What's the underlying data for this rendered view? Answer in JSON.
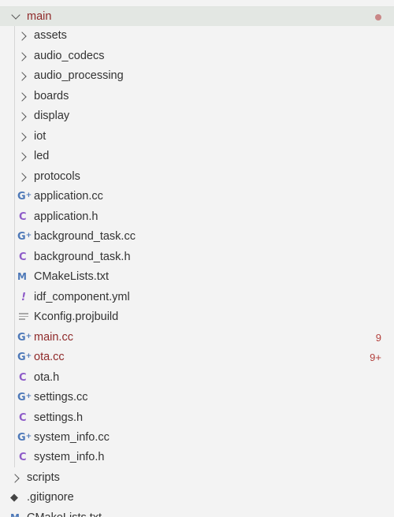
{
  "explorer": {
    "root_folder": {
      "label": "main",
      "expanded": true,
      "status_dot_color": "#c98787"
    },
    "folders": [
      {
        "label": "assets"
      },
      {
        "label": "audio_codecs"
      },
      {
        "label": "audio_processing"
      },
      {
        "label": "boards"
      },
      {
        "label": "display"
      },
      {
        "label": "iot"
      },
      {
        "label": "led"
      },
      {
        "label": "protocols"
      }
    ],
    "files": [
      {
        "label": "application.cc",
        "icon": "cpp-file-icon",
        "badge": ""
      },
      {
        "label": "application.h",
        "icon": "c-header-file-icon",
        "badge": ""
      },
      {
        "label": "background_task.cc",
        "icon": "cpp-file-icon",
        "badge": ""
      },
      {
        "label": "background_task.h",
        "icon": "c-header-file-icon",
        "badge": ""
      },
      {
        "label": "CMakeLists.txt",
        "icon": "cmake-file-icon",
        "badge": ""
      },
      {
        "label": "idf_component.yml",
        "icon": "yaml-file-icon",
        "badge": ""
      },
      {
        "label": "Kconfig.projbuild",
        "icon": "text-file-icon",
        "badge": ""
      },
      {
        "label": "main.cc",
        "icon": "cpp-file-icon",
        "badge": "9"
      },
      {
        "label": "ota.cc",
        "icon": "cpp-file-icon",
        "badge": "9+"
      },
      {
        "label": "ota.h",
        "icon": "c-header-file-icon",
        "badge": ""
      },
      {
        "label": "settings.cc",
        "icon": "cpp-file-icon",
        "badge": ""
      },
      {
        "label": "settings.h",
        "icon": "c-header-file-icon",
        "badge": ""
      },
      {
        "label": "system_info.cc",
        "icon": "cpp-file-icon",
        "badge": ""
      },
      {
        "label": "system_info.h",
        "icon": "c-header-file-icon",
        "badge": ""
      }
    ],
    "sibling_folder": {
      "label": "scripts"
    },
    "root_files": [
      {
        "label": ".gitignore",
        "icon": "git-file-icon"
      },
      {
        "label": "CMakeLists.txt",
        "icon": "cmake-file-icon"
      }
    ],
    "colors": {
      "modified_text": "#8f2a2a",
      "badge_text": "#b3413d",
      "cpp_icon": "#4e79b8",
      "c_header_icon": "#8e5bc8",
      "selected_row_bg": "#e3e7e3"
    }
  }
}
